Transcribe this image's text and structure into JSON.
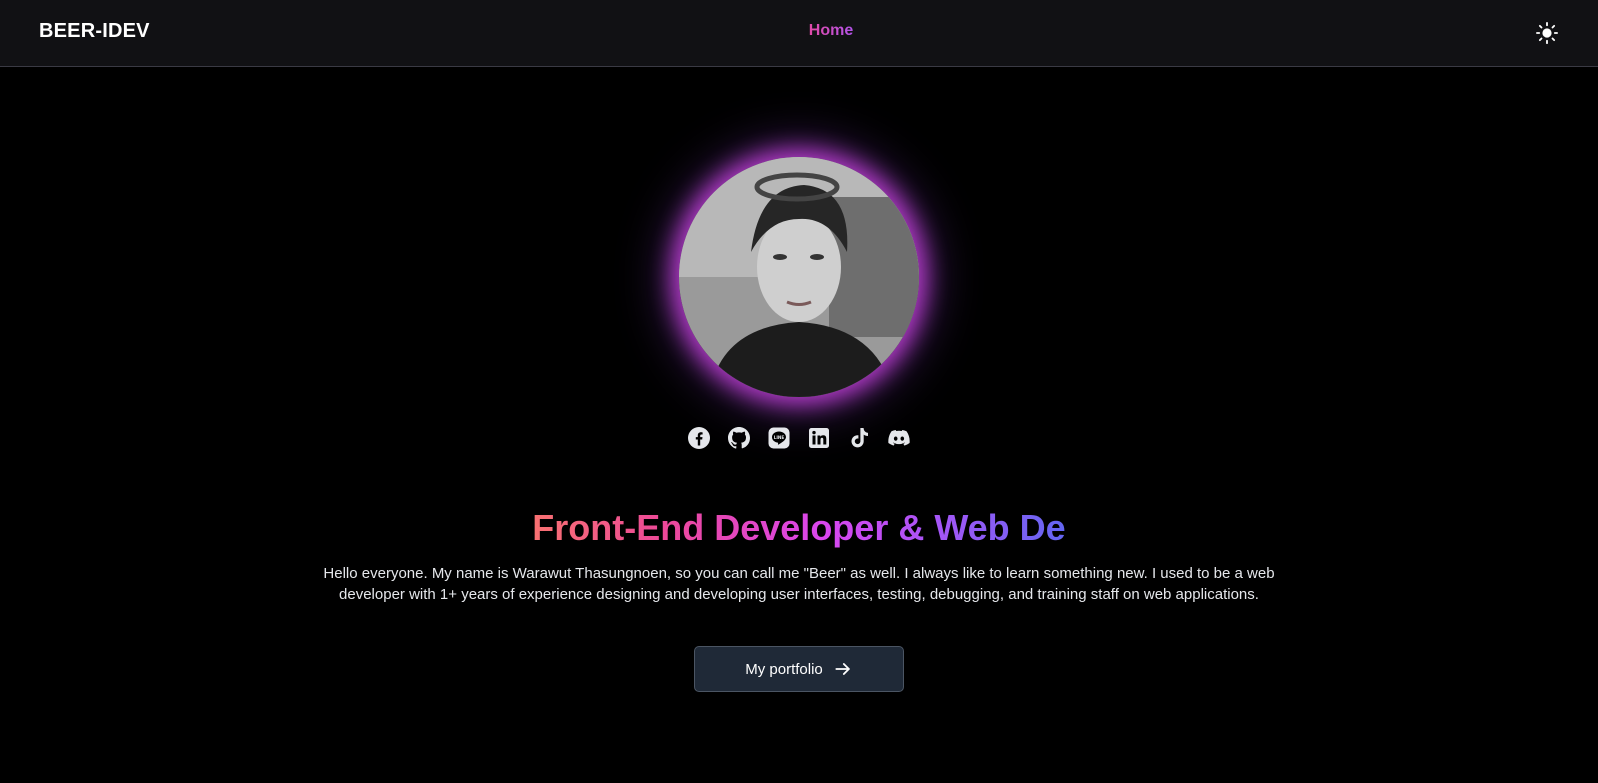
{
  "navbar": {
    "brand": "BEER-IDEV",
    "links": [
      {
        "label": "Home"
      }
    ],
    "theme_toggle_icon": "sun-icon"
  },
  "profile": {
    "avatar_icon": "profile-photo",
    "glow_color": "#d946ef",
    "socials": [
      {
        "name": "facebook-icon"
      },
      {
        "name": "github-icon"
      },
      {
        "name": "line-icon"
      },
      {
        "name": "linkedin-icon"
      },
      {
        "name": "tiktok-icon"
      },
      {
        "name": "discord-icon"
      }
    ]
  },
  "hero": {
    "headline": "Front-End Developer & Web De",
    "intro": "Hello everyone. My name is Warawut Thasungnoen, so you can call me \"Beer\" as well. I always like to learn something new. I used to be a web developer with 1+ years of experience designing and developing user interfaces, testing, debugging, and training staff on web applications.",
    "cta_label": "My portfolio",
    "cta_icon": "arrow-right-icon"
  },
  "colors": {
    "gradient_start": "#f87171",
    "gradient_mid": "#d946ef",
    "gradient_end": "#6366f1",
    "button_bg": "#1f2937"
  }
}
